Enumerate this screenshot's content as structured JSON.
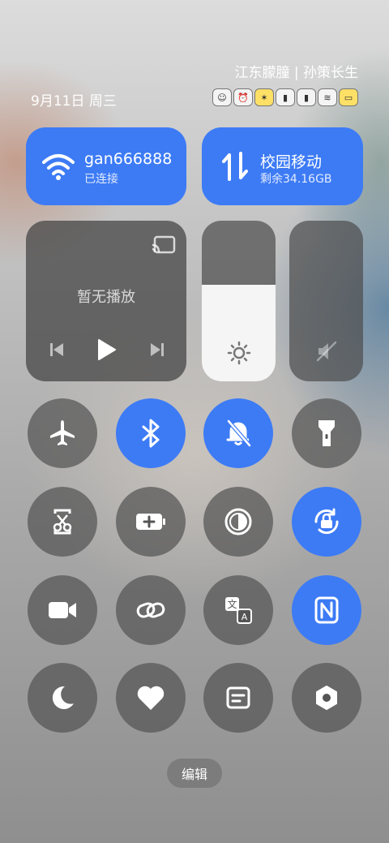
{
  "status": {
    "top_text": "江东朦朣 | 孙策长生",
    "date": "9月11日 周三"
  },
  "wifi": {
    "name": "gan666888",
    "status": "已连接"
  },
  "mobile_data": {
    "name": "校园移动",
    "remaining": "剩余34.16GB"
  },
  "media": {
    "empty_text": "暂无播放"
  },
  "brightness": {
    "level": 0.6
  },
  "volume": {
    "level": 0.0
  },
  "toggles": [
    {
      "name": "airplane-mode",
      "on": false
    },
    {
      "name": "bluetooth",
      "on": true
    },
    {
      "name": "silent-mode",
      "on": true
    },
    {
      "name": "flashlight",
      "on": false
    },
    {
      "name": "screenshot",
      "on": false
    },
    {
      "name": "battery-saver",
      "on": false
    },
    {
      "name": "dark-mode",
      "on": false
    },
    {
      "name": "auto-rotate-lock",
      "on": true
    },
    {
      "name": "screen-record",
      "on": false
    },
    {
      "name": "link-share",
      "on": false
    },
    {
      "name": "translate",
      "on": false
    },
    {
      "name": "nfc",
      "on": true
    },
    {
      "name": "do-not-disturb",
      "on": false
    },
    {
      "name": "health",
      "on": false
    },
    {
      "name": "notes",
      "on": false
    },
    {
      "name": "settings",
      "on": false
    }
  ],
  "edit_label": "编辑",
  "colors": {
    "accent": "#3d7bf5",
    "off": "#555555"
  }
}
